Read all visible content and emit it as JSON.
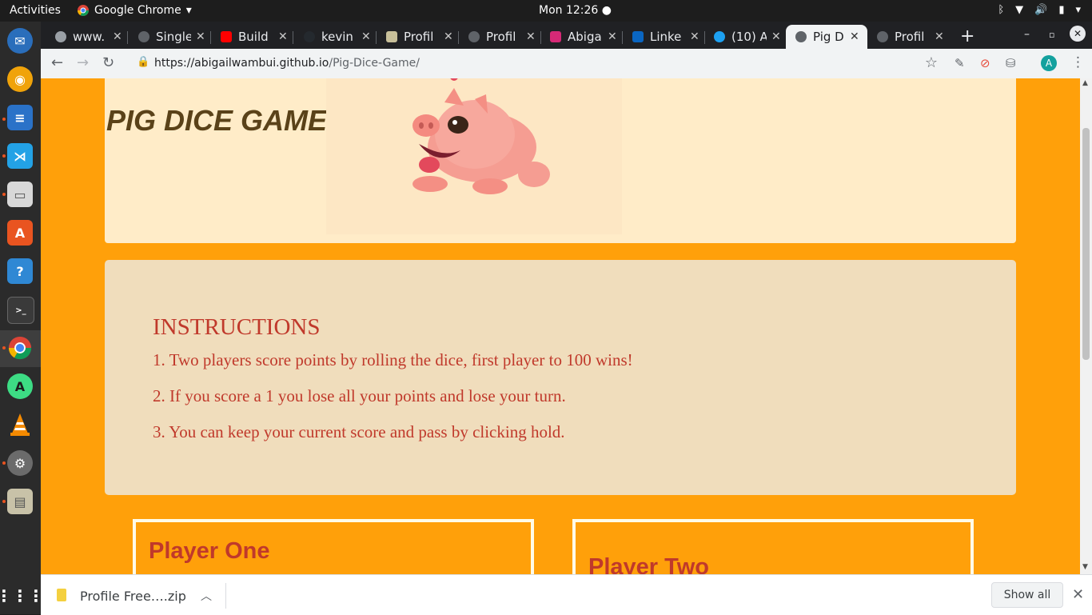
{
  "topbar": {
    "activities": "Activities",
    "app_name": "Google Chrome",
    "clock": "Mon 12:26"
  },
  "dock": {
    "items": [
      "thunderbird-icon",
      "rhythmbox-icon",
      "writer-icon",
      "vscode-icon",
      "files-icon",
      "software-icon",
      "help-icon",
      "terminal-icon",
      "chrome-icon",
      "android-studio-icon",
      "vlc-icon",
      "settings-icon",
      "archive-icon",
      "apps-grid-icon"
    ]
  },
  "tabs": [
    {
      "label": "www.",
      "favicon_color": "#9aa0a6"
    },
    {
      "label": "Single",
      "favicon_color": "#5f6368"
    },
    {
      "label": "Build",
      "favicon_color": "#ff0000"
    },
    {
      "label": "kevin",
      "favicon_color": "#24292e"
    },
    {
      "label": "Profil",
      "favicon_color": "#c8c09a"
    },
    {
      "label": "Profil",
      "favicon_color": "#5f6368"
    },
    {
      "label": "Abiga",
      "favicon_color": "#d62976"
    },
    {
      "label": "Linke",
      "favicon_color": "#0a66c2"
    },
    {
      "label": "(10) A",
      "favicon_color": "#1da1f2"
    },
    {
      "label": "Pig Di",
      "favicon_color": "#5f6368",
      "active": true
    },
    {
      "label": "Profil",
      "favicon_color": "#5f6368"
    }
  ],
  "omnibox": {
    "url_host": "https://abigailwambui.github.io",
    "url_path": "/Pig-Dice-Game/"
  },
  "profile_initial": "A",
  "page": {
    "title": "PIG DICE GAME",
    "instructions_title": "INSTRUCTIONS",
    "instructions": [
      "1. Two players score points by rolling the dice, first player to 100 wins!",
      "2. If you score a 1 you lose all your points and lose your turn.",
      "3. You can keep your current score and pass by clicking hold."
    ],
    "player_one": "Player One",
    "player_two": "Player Two"
  },
  "downloads": {
    "file_name": "Profile Free….zip",
    "show_all": "Show all"
  },
  "colors": {
    "page_bg": "#ffa00a",
    "accent_red": "#c0392b",
    "header_card": "#ffecc8",
    "instructions_card": "#f0ddbc"
  }
}
